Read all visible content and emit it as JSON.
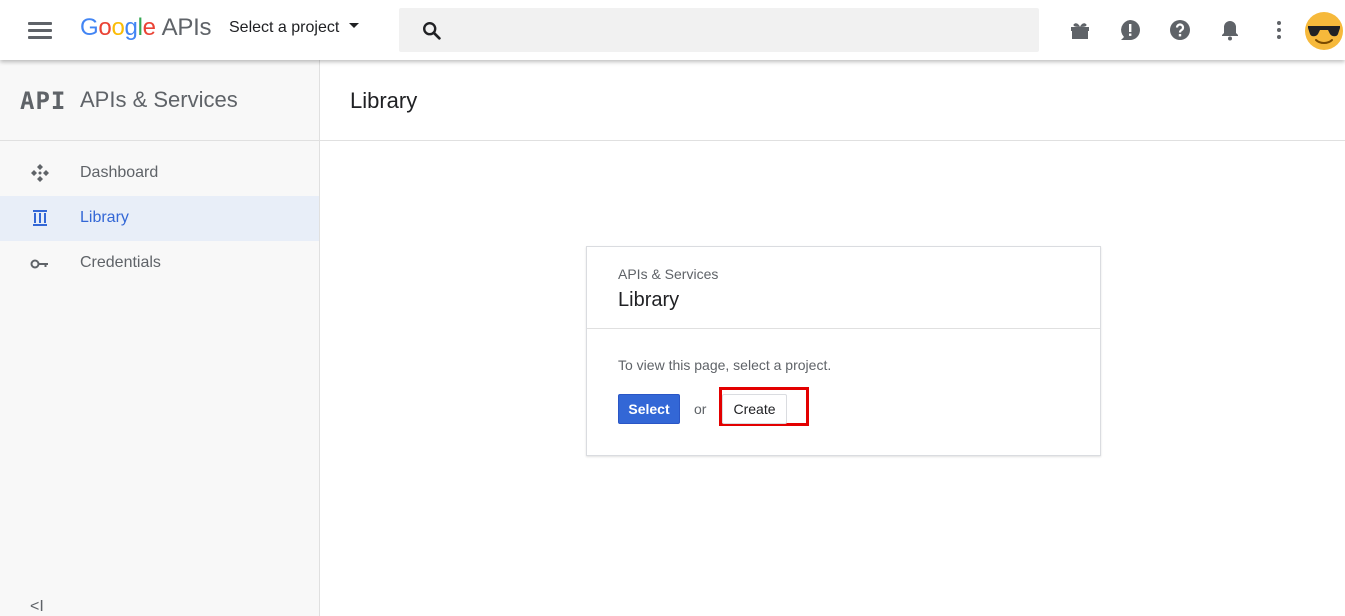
{
  "topbar": {
    "logo": {
      "letters": [
        "G",
        "o",
        "o",
        "g",
        "l",
        "e"
      ],
      "suffix": "APIs"
    },
    "project_selector": "Select a project",
    "search": {
      "value": "",
      "placeholder": ""
    },
    "icons": [
      "gift-icon",
      "feedback-icon",
      "help-icon",
      "notifications-icon",
      "more-vert-icon"
    ],
    "avatar": "sunglasses-emoji-avatar"
  },
  "sidebar": {
    "logo_text": "API",
    "title": "APIs & Services",
    "items": [
      {
        "label": "Dashboard",
        "icon": "dashboard-icon",
        "active": false
      },
      {
        "label": "Library",
        "icon": "library-icon",
        "active": true
      },
      {
        "label": "Credentials",
        "icon": "key-icon",
        "active": false
      }
    ],
    "collapse_glyph": "<I"
  },
  "main": {
    "title": "Library",
    "card": {
      "subtitle": "APIs & Services",
      "title": "Library",
      "message": "To view this page, select a project.",
      "select_label": "Select",
      "or_text": "or",
      "create_label": "Create"
    }
  },
  "colors": {
    "primary": "#3367d6",
    "highlight_box": "#e30000",
    "active_nav_bg": "#e8eef8"
  }
}
